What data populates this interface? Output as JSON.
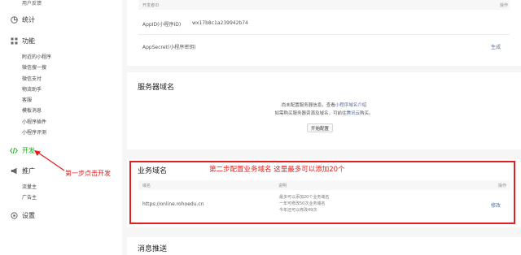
{
  "sidebar": {
    "top_partial": "用户反馈",
    "stats_label": "统计",
    "features_label": "功能",
    "feature_items": [
      "附近的小程序",
      "微信搜一搜",
      "微信支付",
      "物流助手",
      "客服",
      "模板消息",
      "小程序插件",
      "小程序评测"
    ],
    "develop_label": "开发",
    "promo_label": "推广",
    "promo_items": [
      "流量主",
      "广告主"
    ],
    "settings_label": "设置"
  },
  "annotations": {
    "step1": "第一步点击开发",
    "step2": "第二步配置业务域名 这里最多可以添加20个"
  },
  "dev_id": {
    "col_header": "开发者ID",
    "col_action": "操作",
    "appid_label": "AppID(小程序ID)",
    "appid_value": "wx17b8c1a239942b74",
    "secret_label": "AppSecret(小程序密钥)",
    "secret_action": "生成"
  },
  "server_domain": {
    "title": "服务器域名",
    "line1_a": "尚未配置服务器信息，查看",
    "line1_link": "小程序域名介绍",
    "line2_a": "如需购买服务器资源及域名，可前往",
    "line2_link": "腾讯云",
    "line2_b": "购买。",
    "button": "开始配置"
  },
  "business_domain": {
    "title": "业务域名",
    "col_domain": "域名",
    "col_desc": "说明",
    "col_action": "操作",
    "domain_value": "https://online.rohoedu.cn",
    "desc_lines": [
      "最多可以添加20个业务域名",
      "一年可修改50次业务域名",
      "今年还可以修改49次"
    ],
    "action": "修改"
  },
  "message_push": {
    "title": "消息推送"
  }
}
